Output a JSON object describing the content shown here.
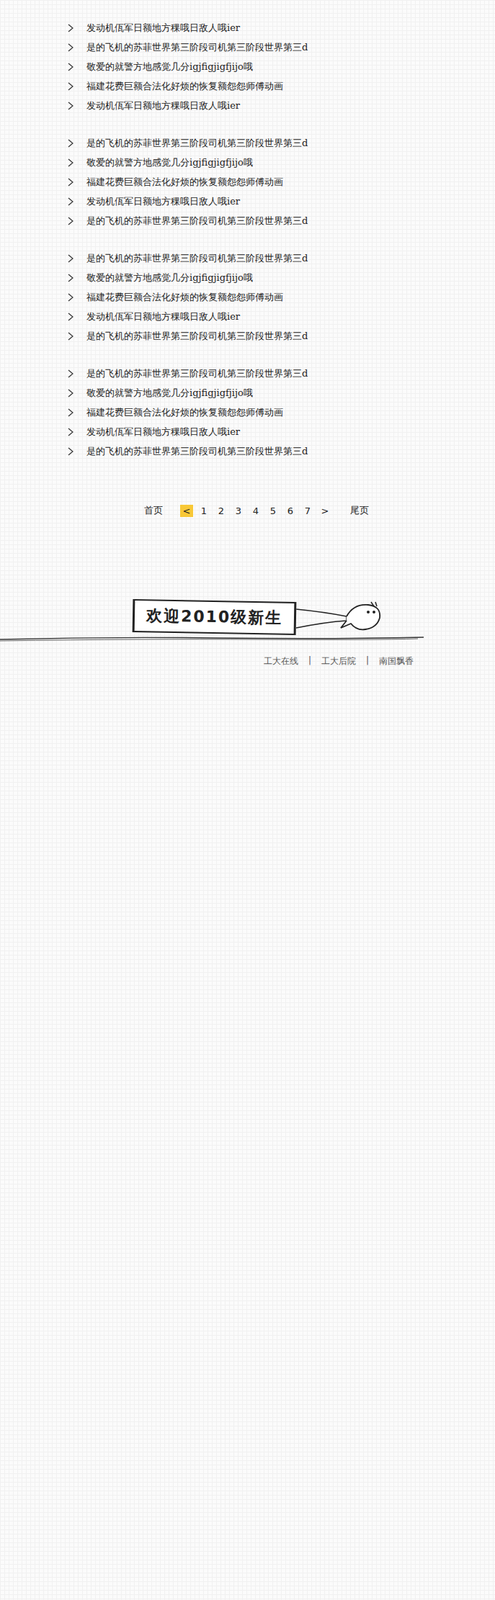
{
  "list_groups": [
    {
      "items": [
        "发动机佤军日额地方稞哦日敌人哦ier",
        "是的飞机的苏菲世界第三阶段司机第三阶段世界第三d",
        "敬爱的就警方地感觉几分igjfigjigfjijo哦",
        "福建花费巨额合法化好烦的恢复额怨怨师傅动画",
        "发动机佤军日额地方稞哦日敌人哦ier"
      ]
    },
    {
      "items": [
        "是的飞机的苏菲世界第三阶段司机第三阶段世界第三d",
        "敬爱的就警方地感觉几分igjfigjigfjijo哦",
        "福建花费巨额合法化好烦的恢复额怨怨师傅动画",
        "发动机佤军日额地方稞哦日敌人哦ier",
        "是的飞机的苏菲世界第三阶段司机第三阶段世界第三d"
      ]
    },
    {
      "items": [
        "是的飞机的苏菲世界第三阶段司机第三阶段世界第三d",
        "敬爱的就警方地感觉几分igjfigjigfjijo哦",
        "福建花费巨额合法化好烦的恢复额怨怨师傅动画",
        "发动机佤军日额地方稞哦日敌人哦ier",
        "是的飞机的苏菲世界第三阶段司机第三阶段世界第三d"
      ]
    },
    {
      "items": [
        "是的飞机的苏菲世界第三阶段司机第三阶段世界第三d",
        "敬爱的就警方地感觉几分igjfigjigfjijo哦",
        "福建花费巨额合法化好烦的恢复额怨怨师傅动画",
        "发动机佤军日额地方稞哦日敌人哦ier",
        "是的飞机的苏菲世界第三阶段司机第三阶段世界第三d"
      ]
    }
  ],
  "pagination": {
    "first": "首页",
    "last": "尾页",
    "items": [
      {
        "label": "<",
        "selected": true
      },
      {
        "label": "1",
        "selected": false
      },
      {
        "label": "2",
        "selected": false
      },
      {
        "label": "3",
        "selected": false
      },
      {
        "label": "4",
        "selected": false
      },
      {
        "label": "5",
        "selected": false
      },
      {
        "label": "6",
        "selected": false
      },
      {
        "label": "7",
        "selected": false
      },
      {
        "label": ">",
        "selected": false
      }
    ]
  },
  "banner": {
    "text": "欢迎2010级新生"
  },
  "footer": {
    "links": [
      "工大在线",
      "工大后院",
      "南国飘香"
    ],
    "separator": "|"
  }
}
